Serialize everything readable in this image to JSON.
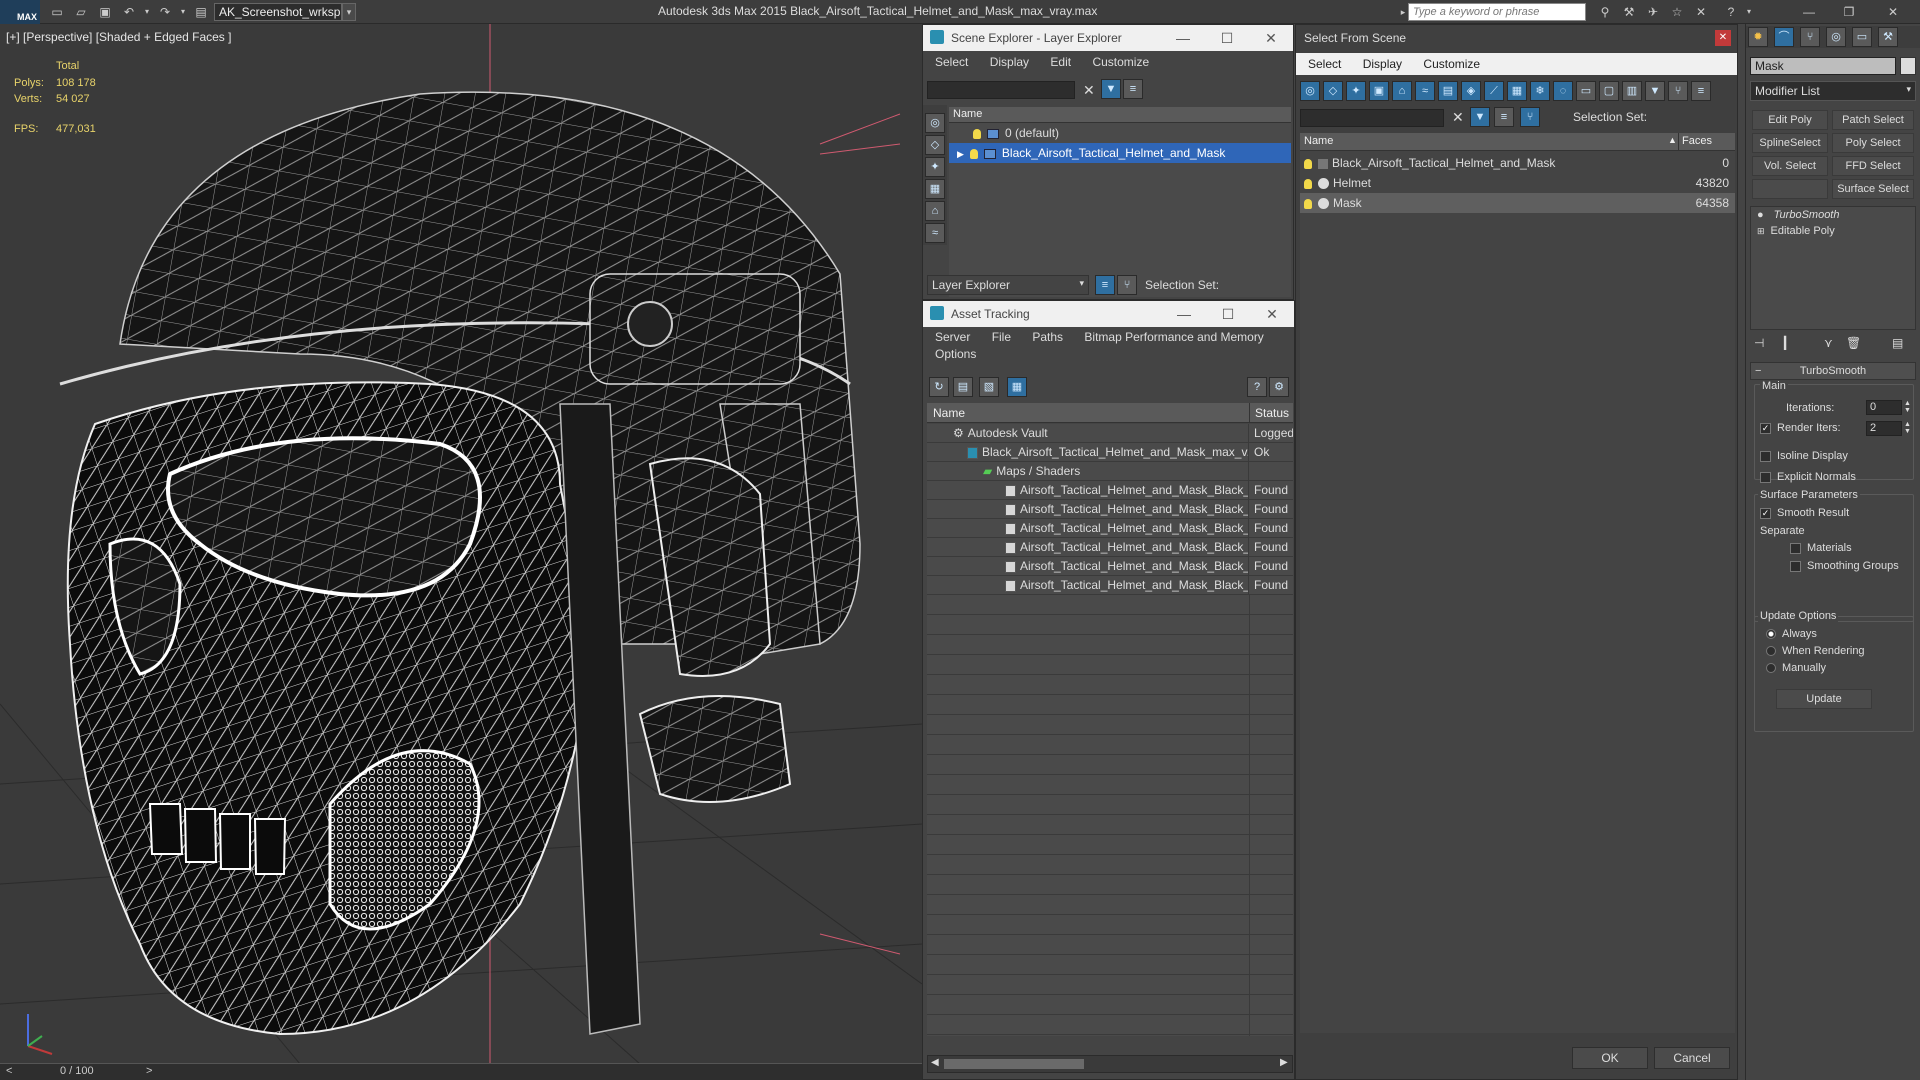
{
  "titlebar": {
    "logo_text": "MAX",
    "workspace": "AK_Screenshot_wrksp",
    "title": "Autodesk 3ds Max  2015     Black_Airsoft_Tactical_Helmet_and_Mask_max_vray.max",
    "search_placeholder": "Type a keyword or phrase"
  },
  "viewport": {
    "label": "[+] [Perspective] [Shaded + Edged Faces ]",
    "stats": {
      "total_label": "Total",
      "polys_label": "Polys:",
      "polys_value": "108 178",
      "verts_label": "Verts:",
      "verts_value": "54 027",
      "fps_label": "FPS:",
      "fps_value": "477,031"
    }
  },
  "timeline": {
    "text": "0 / 100",
    "prev": "<",
    "next": ">"
  },
  "scene_explorer": {
    "title": "Scene Explorer - Layer Explorer",
    "menu": [
      "Select",
      "Display",
      "Edit",
      "Customize"
    ],
    "column_name": "Name",
    "rows": [
      "0 (default)",
      "Black_Airsoft_Tactical_Helmet_and_Mask"
    ],
    "footer_combo": "Layer Explorer",
    "selection_set_label": "Selection Set:"
  },
  "asset_tracking": {
    "title": "Asset Tracking",
    "menu_line1": [
      "Server",
      "File",
      "Paths",
      "Bitmap Performance and Memory"
    ],
    "menu_line2": [
      "Options"
    ],
    "col_name": "Name",
    "col_status": "Status",
    "rows": [
      {
        "name": "Autodesk Vault",
        "status": "Logged"
      },
      {
        "name": "Black_Airsoft_Tactical_Helmet_and_Mask_max_v...",
        "status": "Ok"
      },
      {
        "name": "Maps / Shaders",
        "status": ""
      },
      {
        "name": "Airsoft_Tactical_Helmet_and_Mask_Black_...",
        "status": "Found"
      },
      {
        "name": "Airsoft_Tactical_Helmet_and_Mask_Black_...",
        "status": "Found"
      },
      {
        "name": "Airsoft_Tactical_Helmet_and_Mask_Black_...",
        "status": "Found"
      },
      {
        "name": "Airsoft_Tactical_Helmet_and_Mask_Black_...",
        "status": "Found"
      },
      {
        "name": "Airsoft_Tactical_Helmet_and_Mask_Black_...",
        "status": "Found"
      },
      {
        "name": "Airsoft_Tactical_Helmet_and_Mask_Black_...",
        "status": "Found"
      }
    ]
  },
  "select_from_scene": {
    "title": "Select From Scene",
    "menu": [
      "Select",
      "Display",
      "Customize"
    ],
    "selection_set_label": "Selection Set:",
    "col_name": "Name",
    "col_faces": "Faces",
    "rows": [
      {
        "name": "Black_Airsoft_Tactical_Helmet_and_Mask",
        "faces": "0"
      },
      {
        "name": "Helmet",
        "faces": "43820"
      },
      {
        "name": "Mask",
        "faces": "64358"
      }
    ],
    "ok": "OK",
    "cancel": "Cancel"
  },
  "command_panel": {
    "object_name": "Mask",
    "modifier_list": "Modifier List",
    "buttons": [
      "Edit Poly",
      "Patch Select",
      "SplineSelect",
      "Poly Select",
      "Vol. Select",
      "FFD Select",
      "Surface Select"
    ],
    "stack": [
      "TurboSmooth",
      "Editable Poly"
    ],
    "rollout_title": "TurboSmooth",
    "main_label": "Main",
    "iterations_label": "Iterations:",
    "iterations_value": "0",
    "render_iters_label": "Render Iters:",
    "render_iters_value": "2",
    "isoline": "Isoline Display",
    "explicit_normals": "Explicit Normals",
    "surface_params": "Surface Parameters",
    "smooth_result": "Smooth Result",
    "separate": "Separate",
    "materials": "Materials",
    "smoothing_groups": "Smoothing Groups",
    "update_options": "Update Options",
    "always": "Always",
    "when_rendering": "When Rendering",
    "manually": "Manually",
    "update_button": "Update"
  }
}
